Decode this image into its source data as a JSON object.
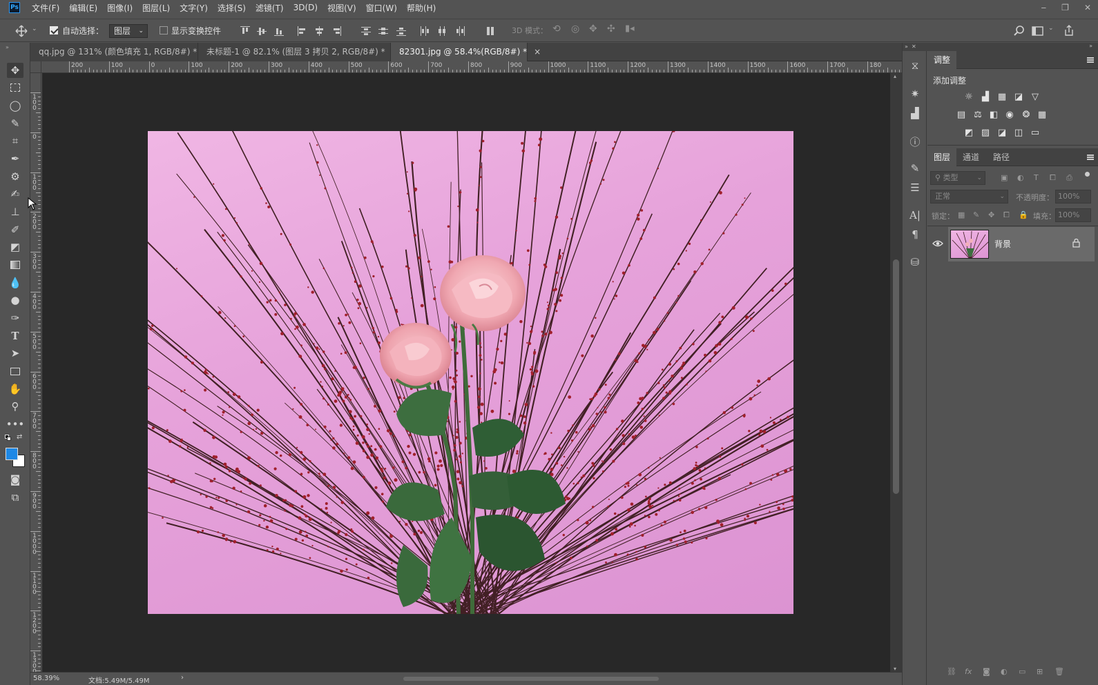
{
  "app": {
    "logo": "Ps"
  },
  "menu": [
    "文件(F)",
    "编辑(E)",
    "图像(I)",
    "图层(L)",
    "文字(Y)",
    "选择(S)",
    "滤镜(T)",
    "3D(D)",
    "视图(V)",
    "窗口(W)",
    "帮助(H)"
  ],
  "window_controls": {
    "minimize": "‒",
    "restore": "❐",
    "close": "✕"
  },
  "options": {
    "auto_select_label": "自动选择：",
    "auto_select_checked": true,
    "auto_select_target": "图层",
    "show_transform_label": "显示变换控件",
    "show_transform_checked": false,
    "mode_3d_label": "3D 模式："
  },
  "tabs": [
    {
      "label": "qq.jpg @ 131% (颜色填充 1, RGB/8#) *",
      "close": "×",
      "active": false
    },
    {
      "label": "未标题-1 @ 82.1% (图层 3 拷贝 2, RGB/8#) *",
      "close": "×",
      "active": false
    },
    {
      "label": "82301.jpg @ 58.4%(RGB/8#) *",
      "close": "×",
      "active": true
    }
  ],
  "ruler": {
    "h_labels": [
      "200",
      "100",
      "0",
      "100",
      "200",
      "300",
      "400",
      "500",
      "600",
      "700",
      "800",
      "900",
      "1000",
      "1100",
      "1200",
      "1300",
      "1400",
      "1500",
      "1600",
      "1700",
      "180"
    ],
    "v_labels": [
      "100",
      "0",
      "100",
      "200",
      "300",
      "400",
      "500",
      "600",
      "700",
      "800",
      "900",
      "1000",
      "1100",
      "1200",
      "1300"
    ]
  },
  "status": {
    "zoom": "58.39%",
    "doc": "文档:5.49M/5.49M"
  },
  "adjustments_panel": {
    "tab": "调整",
    "heading": "添加调整",
    "row1": [
      "brightness-icon",
      "levels-icon",
      "curves-icon",
      "exposure-icon",
      "vibrance-icon"
    ],
    "row2": [
      "hue-icon",
      "color-balance-icon",
      "black-white-icon",
      "photo-filter-icon",
      "channel-mixer-icon",
      "color-lookup-icon"
    ],
    "row3": [
      "invert-icon",
      "posterize-icon",
      "threshold-icon",
      "selective-color-icon",
      "gradient-map-icon"
    ]
  },
  "layers_panel": {
    "tabs": [
      "图层",
      "通道",
      "路径"
    ],
    "filter_placeholder": "类型",
    "blend_mode": "正常",
    "opacity_label": "不透明度：",
    "opacity_value": "100%",
    "lock_label": "锁定：",
    "fill_label": "填充：",
    "fill_value": "100%",
    "layers": [
      {
        "name": "背景",
        "visible": true,
        "locked": true
      }
    ]
  },
  "colors": {
    "foreground": "#1e88e5",
    "background": "#ffffff",
    "canvas_bg": "#282828"
  }
}
